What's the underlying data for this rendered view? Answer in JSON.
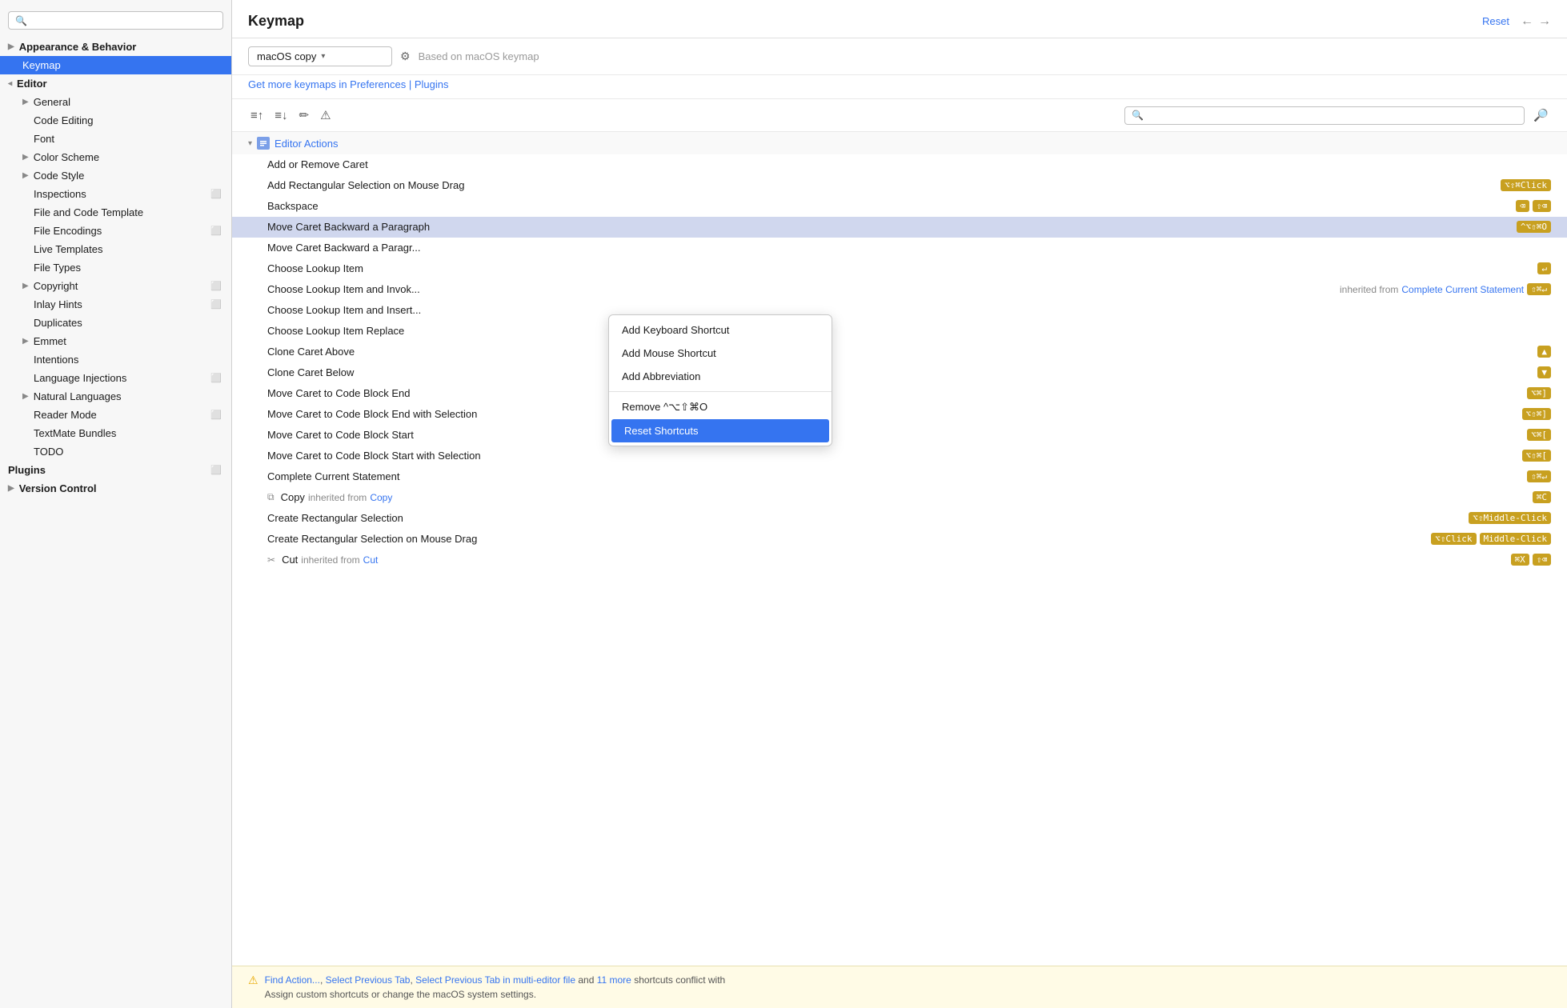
{
  "sidebar": {
    "search_placeholder": "🔍",
    "items": [
      {
        "id": "appearance-behavior",
        "label": "Appearance & Behavior",
        "indent": "section-header",
        "chevron": "▶",
        "level": 0,
        "expandable": true
      },
      {
        "id": "keymap",
        "label": "Keymap",
        "indent": 1,
        "selected": true
      },
      {
        "id": "editor",
        "label": "Editor",
        "indent": "section-header",
        "chevron": "▾",
        "level": 0,
        "expandable": true,
        "open": true
      },
      {
        "id": "general",
        "label": "General",
        "indent": 1,
        "chevron": "▶",
        "expandable": true
      },
      {
        "id": "code-editing",
        "label": "Code Editing",
        "indent": 2
      },
      {
        "id": "font",
        "label": "Font",
        "indent": 2
      },
      {
        "id": "color-scheme",
        "label": "Color Scheme",
        "indent": 1,
        "chevron": "▶",
        "expandable": true
      },
      {
        "id": "code-style",
        "label": "Code Style",
        "indent": 1,
        "chevron": "▶",
        "expandable": true
      },
      {
        "id": "inspections",
        "label": "Inspections",
        "indent": 2,
        "has_right_icon": true
      },
      {
        "id": "file-and-code-templates",
        "label": "File and Code Template",
        "indent": 2,
        "truncated": true
      },
      {
        "id": "file-encodings",
        "label": "File Encodings",
        "indent": 2,
        "has_right_icon": true
      },
      {
        "id": "live-templates",
        "label": "Live Templates",
        "indent": 2
      },
      {
        "id": "file-types",
        "label": "File Types",
        "indent": 2
      },
      {
        "id": "copyright",
        "label": "Copyright",
        "indent": 1,
        "chevron": "▶",
        "expandable": true,
        "has_right_icon": true
      },
      {
        "id": "inlay-hints",
        "label": "Inlay Hints",
        "indent": 2,
        "has_right_icon": true
      },
      {
        "id": "duplicates",
        "label": "Duplicates",
        "indent": 2
      },
      {
        "id": "emmet",
        "label": "Emmet",
        "indent": 1,
        "chevron": "▶",
        "expandable": true
      },
      {
        "id": "intentions",
        "label": "Intentions",
        "indent": 2
      },
      {
        "id": "language-injections",
        "label": "Language Injections",
        "indent": 2,
        "has_right_icon": true
      },
      {
        "id": "natural-languages",
        "label": "Natural Languages",
        "indent": 1,
        "chevron": "▶",
        "expandable": true
      },
      {
        "id": "reader-mode",
        "label": "Reader Mode",
        "indent": 2,
        "has_right_icon": true
      },
      {
        "id": "textmate-bundles",
        "label": "TextMate Bundles",
        "indent": 2
      },
      {
        "id": "todo",
        "label": "TODO",
        "indent": 2
      },
      {
        "id": "plugins",
        "label": "Plugins",
        "indent": "section-header",
        "has_right_icon": true
      },
      {
        "id": "version-control",
        "label": "Version Control",
        "indent": "section-header",
        "chevron": "▶",
        "expandable": true
      }
    ]
  },
  "header": {
    "title": "Keymap",
    "reset_label": "Reset",
    "nav_back": "←",
    "nav_forward": "→"
  },
  "keymap": {
    "selected_profile": "macOS copy",
    "based_on": "Based on macOS keymap",
    "link_text": "Get more keymaps in Preferences | Plugins"
  },
  "toolbar": {
    "icons": [
      "≡↑",
      "≡↓",
      "✏",
      "⚠"
    ],
    "search_placeholder": "🔍"
  },
  "actions": {
    "group_label": "Editor Actions",
    "group_chevron": "▾",
    "rows": [
      {
        "id": "add-remove-caret",
        "name": "Add or Remove Caret",
        "shortcuts": []
      },
      {
        "id": "add-rect-selection",
        "name": "Add Rectangular Selection on Mouse Drag",
        "shortcuts": [
          {
            "text": "⌥⇧⌘Click",
            "type": "kbd"
          }
        ]
      },
      {
        "id": "backspace",
        "name": "Backspace",
        "shortcuts": [
          {
            "text": "⌫",
            "type": "kbd"
          },
          {
            "text": "⇧⌫",
            "type": "kbd"
          }
        ]
      },
      {
        "id": "move-caret-backward-para",
        "name": "Move Caret Backward a Paragraph",
        "shortcuts": [
          {
            "text": "^⌥⇧⌘O",
            "type": "kbd"
          }
        ],
        "highlighted": true,
        "context_selected": true
      },
      {
        "id": "move-caret-backward-para2",
        "name": "Move Caret Backward a Paragr...",
        "shortcuts": []
      },
      {
        "id": "choose-lookup-item",
        "name": "Choose Lookup Item",
        "shortcuts": [
          {
            "text": "↵",
            "type": "kbd"
          }
        ]
      },
      {
        "id": "choose-lookup-invoke",
        "name": "Choose Lookup Item and Invok...",
        "shortcuts": [],
        "inherit": true,
        "inherit_text": "inherited from",
        "inherit_link": "Complete Current Statement",
        "inherit_shortcut": "⇧⌘↵"
      },
      {
        "id": "choose-lookup-insert",
        "name": "Choose Lookup Item and Insert...",
        "shortcuts": []
      },
      {
        "id": "choose-lookup-replace",
        "name": "Choose Lookup Item Replace",
        "shortcuts": []
      },
      {
        "id": "clone-caret-above",
        "name": "Clone Caret Above",
        "shortcuts": [
          {
            "text": "▲",
            "type": "arrow-icon"
          }
        ]
      },
      {
        "id": "clone-caret-below",
        "name": "Clone Caret Below",
        "shortcuts": [
          {
            "text": "▼",
            "type": "arrow-icon"
          }
        ]
      },
      {
        "id": "move-caret-code-block-end",
        "name": "Move Caret to Code Block End",
        "shortcuts": [
          {
            "text": "⌥⌘]",
            "type": "kbd"
          }
        ]
      },
      {
        "id": "move-caret-code-block-end-sel",
        "name": "Move Caret to Code Block End with Selection",
        "shortcuts": [
          {
            "text": "⌥⇧⌘]",
            "type": "kbd"
          }
        ]
      },
      {
        "id": "move-caret-code-block-start",
        "name": "Move Caret to Code Block Start",
        "shortcuts": [
          {
            "text": "⌥⌘[",
            "type": "kbd"
          }
        ]
      },
      {
        "id": "move-caret-code-block-start-sel",
        "name": "Move Caret to Code Block Start with Selection",
        "shortcuts": [
          {
            "text": "⌥⇧⌘[",
            "type": "kbd"
          }
        ]
      },
      {
        "id": "complete-current-statement",
        "name": "Complete Current Statement",
        "shortcuts": [
          {
            "text": "⇧⌘↵",
            "type": "kbd"
          }
        ]
      },
      {
        "id": "copy",
        "name": "Copy",
        "muted": true,
        "has_copy_icon": true,
        "inherit_prefix": "inherited from",
        "inherit_link": "Copy",
        "shortcuts": [
          {
            "text": "⌘C",
            "type": "kbd"
          }
        ]
      },
      {
        "id": "create-rect-selection",
        "name": "Create Rectangular Selection",
        "shortcuts": [
          {
            "text": "⌥⇧Middle-Click",
            "type": "kbd-wide"
          }
        ]
      },
      {
        "id": "create-rect-selection-drag",
        "name": "Create Rectangular Selection on Mouse Drag",
        "shortcuts": [
          {
            "text": "⌥⇧Click",
            "type": "kbd"
          },
          {
            "text": "Middle-Click",
            "type": "kbd-wide"
          }
        ]
      },
      {
        "id": "cut",
        "name": "Cut",
        "muted": true,
        "has_scissors_icon": true,
        "inherit_prefix": "inherited from",
        "inherit_link": "Cut",
        "shortcuts": [
          {
            "text": "⌘X",
            "type": "kbd"
          },
          {
            "text": "⇧⌫",
            "type": "kbd"
          }
        ]
      }
    ]
  },
  "context_menu": {
    "items": [
      {
        "id": "add-keyboard-shortcut",
        "label": "Add Keyboard Shortcut"
      },
      {
        "id": "add-mouse-shortcut",
        "label": "Add Mouse Shortcut"
      },
      {
        "id": "add-abbreviation",
        "label": "Add Abbreviation"
      },
      {
        "id": "divider",
        "type": "divider"
      },
      {
        "id": "remove",
        "label": "Remove ^⌥⇧⌘O"
      },
      {
        "id": "reset-shortcuts",
        "label": "Reset Shortcuts",
        "selected": true
      }
    ]
  },
  "warning_bar": {
    "icon": "⚠",
    "text_pre": "",
    "links": [
      "Find Action...",
      "Select Previous Tab",
      "Select Previous Tab in multi-editor file"
    ],
    "text_and": "and",
    "more_link": "11 more",
    "text_suffix": "shortcuts conflict with",
    "line2": "Assign custom shortcuts or change the macOS system settings."
  }
}
